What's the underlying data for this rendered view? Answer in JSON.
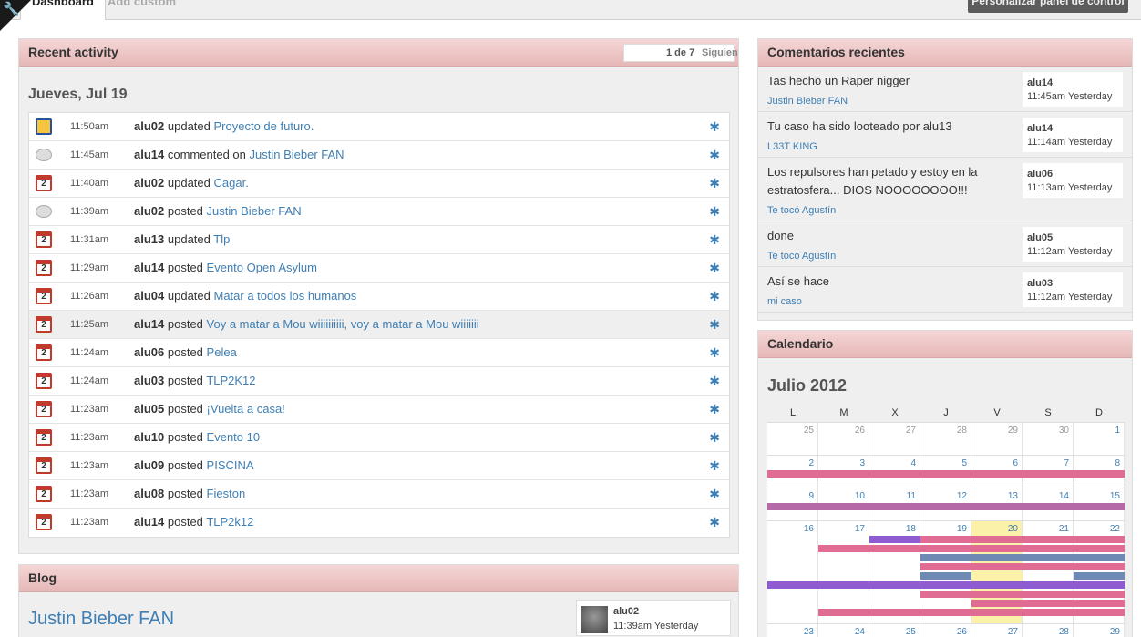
{
  "topbar": {
    "tab_dashboard": "Dashboard",
    "tab_add": "Add custom",
    "customize": "Personalizar panel de control"
  },
  "activity": {
    "title": "Recent activity",
    "pager": "1 de 7",
    "next": "Siguien",
    "day": "Jueves, Jul 19",
    "rows": [
      {
        "icon": "project-icon",
        "time": "11:50am",
        "user": "alu02",
        "action": "updated",
        "target": "Proyecto de futuro."
      },
      {
        "icon": "comment-icon",
        "time": "11:45am",
        "user": "alu14",
        "action": "commented on",
        "target": "Justin Bieber FAN"
      },
      {
        "icon": "calendar-icon",
        "time": "11:40am",
        "user": "alu02",
        "action": "updated",
        "target": "Cagar."
      },
      {
        "icon": "comment-icon",
        "time": "11:39am",
        "user": "alu02",
        "action": "posted",
        "target": "Justin Bieber FAN"
      },
      {
        "icon": "calendar-icon",
        "time": "11:31am",
        "user": "alu13",
        "action": "updated",
        "target": "Tlp"
      },
      {
        "icon": "calendar-icon",
        "time": "11:29am",
        "user": "alu14",
        "action": "posted",
        "target": "Evento Open Asylum"
      },
      {
        "icon": "calendar-icon",
        "time": "11:26am",
        "user": "alu04",
        "action": "updated",
        "target": "Matar a todos los humanos"
      },
      {
        "icon": "calendar-icon",
        "time": "11:25am",
        "user": "alu14",
        "action": "posted",
        "target": "Voy a matar a Mou wiiiiiiiiii, voy a matar a Mou wiiiiiii"
      },
      {
        "icon": "calendar-icon",
        "time": "11:24am",
        "user": "alu06",
        "action": "posted",
        "target": "Pelea"
      },
      {
        "icon": "calendar-icon",
        "time": "11:24am",
        "user": "alu03",
        "action": "posted",
        "target": "TLP2K12"
      },
      {
        "icon": "calendar-icon",
        "time": "11:23am",
        "user": "alu05",
        "action": "posted",
        "target": "¡Vuelta a casa!"
      },
      {
        "icon": "calendar-icon",
        "time": "11:23am",
        "user": "alu10",
        "action": "posted",
        "target": "Evento 10"
      },
      {
        "icon": "calendar-icon",
        "time": "11:23am",
        "user": "alu09",
        "action": "posted",
        "target": "PISCINA"
      },
      {
        "icon": "calendar-icon",
        "time": "11:23am",
        "user": "alu08",
        "action": "posted",
        "target": "Fieston"
      },
      {
        "icon": "calendar-icon",
        "time": "11:23am",
        "user": "alu14",
        "action": "posted",
        "target": "TLP2k12"
      }
    ]
  },
  "blog": {
    "title": "Blog",
    "post_title": "Justin Bieber FAN",
    "user": "alu02",
    "time": "11:39am Yesterday"
  },
  "comments": {
    "title": "Comentarios recientes",
    "items": [
      {
        "text": "Tas hecho un Raper nigger",
        "link": "Justin Bieber FAN",
        "user": "alu14",
        "time": "11:45am Yesterday"
      },
      {
        "text": "Tu caso ha sido looteado por alu13",
        "link": "L33T KING",
        "user": "alu14",
        "time": "11:14am Yesterday"
      },
      {
        "text": "Los repulsores han petado y estoy en la estratosfera... DIOS NOOOOOOOO!!!",
        "link": "Te tocó Agustín",
        "user": "alu06",
        "time": "11:13am Yesterday"
      },
      {
        "text": "done",
        "link": "Te tocó Agustín",
        "user": "alu05",
        "time": "11:12am Yesterday"
      },
      {
        "text": "Así se hace",
        "link": "mi caso",
        "user": "alu03",
        "time": "11:12am Yesterday"
      }
    ]
  },
  "calendar": {
    "title": "Calendario",
    "month": "Julio 2012",
    "dow": [
      "L",
      "M",
      "X",
      "J",
      "V",
      "S",
      "D"
    ],
    "weeks": [
      [
        "25",
        "26",
        "27",
        "28",
        "29",
        "30",
        "1"
      ],
      [
        "2",
        "3",
        "4",
        "5",
        "6",
        "7",
        "8"
      ],
      [
        "9",
        "10",
        "11",
        "12",
        "13",
        "14",
        "15"
      ],
      [
        "16",
        "17",
        "18",
        "19",
        "20",
        "21",
        "22"
      ],
      [
        "23",
        "24",
        "25",
        "26",
        "27",
        "28",
        "29"
      ]
    ],
    "today": "20",
    "colors": {
      "pink": "#e06c93",
      "purple": "#8e5bd1",
      "mauve": "#b56aa7",
      "blue": "#6f89b5",
      "yellow": "#fbf1a9"
    }
  }
}
